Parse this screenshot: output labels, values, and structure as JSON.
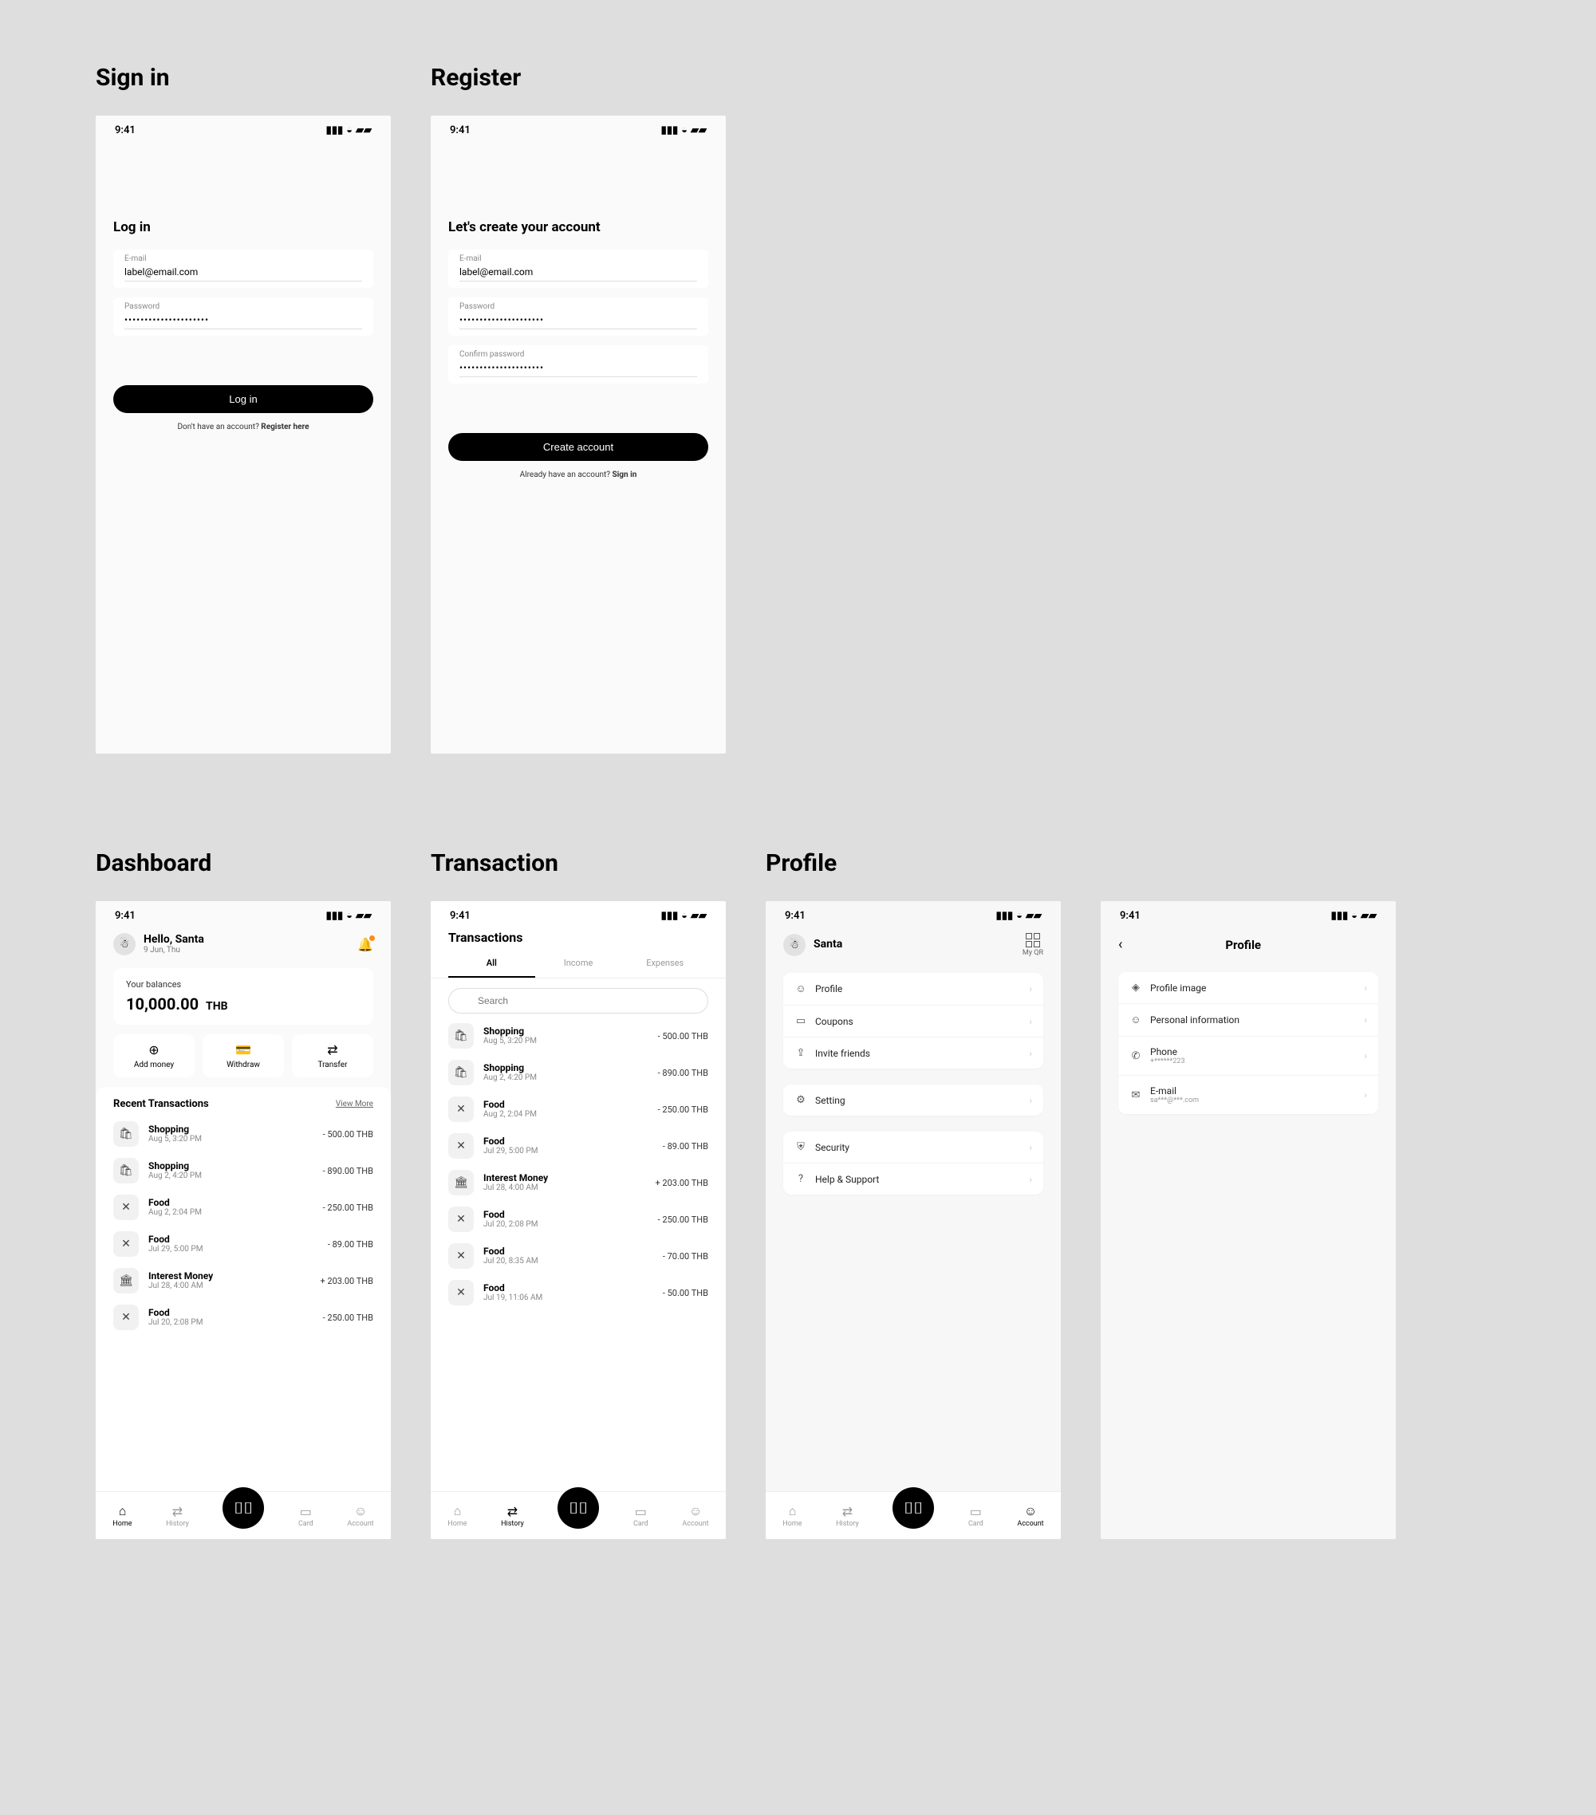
{
  "status": {
    "time": "9:41"
  },
  "signin": {
    "section": "Sign in",
    "heading": "Log in",
    "email_label": "E-mail",
    "email_value": "label@email.com",
    "password_label": "Password",
    "password_value": "•••••••••••••••••••••",
    "button": "Log in",
    "sub_pre": "Don't have an account? ",
    "sub_bold": "Register here"
  },
  "register": {
    "section": "Register",
    "heading": "Let's create your account",
    "email_label": "E-mail",
    "email_value": "label@email.com",
    "password_label": "Password",
    "password_value": "•••••••••••••••••••••",
    "confirm_label": "Confirm password",
    "confirm_value": "•••••••••••••••••••••",
    "button": "Create account",
    "sub_pre": "Already have an account? ",
    "sub_bold": "Sign in"
  },
  "dashboard": {
    "section": "Dashboard",
    "greeting": "Hello, Santa",
    "date": "9 Jun, Thu",
    "balance_label": "Your balances",
    "balance_amount": "10,000.00",
    "balance_currency": "THB",
    "actions": {
      "add": "Add money",
      "withdraw": "Withdraw",
      "transfer": "Transfer"
    },
    "recent_title": "Recent Transactions",
    "view_more": "View More",
    "tx": [
      {
        "icon": "bag",
        "title": "Shopping",
        "date": "Aug 5, 3:20 PM",
        "amount": "- 500.00  THB"
      },
      {
        "icon": "bag",
        "title": "Shopping",
        "date": "Aug 2, 4:20 PM",
        "amount": "- 890.00  THB"
      },
      {
        "icon": "food",
        "title": "Food",
        "date": "Aug 2, 2:04 PM",
        "amount": "- 250.00  THB"
      },
      {
        "icon": "food",
        "title": "Food",
        "date": "Jul 29, 5:00 PM",
        "amount": "- 89.00  THB"
      },
      {
        "icon": "bank",
        "title": "Interest Money",
        "date": "Jul 28, 4:00 AM",
        "amount": "+ 203.00  THB"
      },
      {
        "icon": "food",
        "title": "Food",
        "date": "Jul 20, 2:08 PM",
        "amount": "- 250.00  THB"
      }
    ],
    "nav": {
      "home": "Home",
      "history": "History",
      "card": "Card",
      "account": "Account"
    }
  },
  "transactions": {
    "section": "Transaction",
    "title": "Transactions",
    "tabs": {
      "all": "All",
      "income": "Income",
      "expenses": "Expenses"
    },
    "search_placeholder": "Search",
    "tx": [
      {
        "icon": "bag",
        "title": "Shopping",
        "date": "Aug 5, 3:20 PM",
        "amount": "- 500.00  THB"
      },
      {
        "icon": "bag",
        "title": "Shopping",
        "date": "Aug 2, 4:20 PM",
        "amount": "- 890.00  THB"
      },
      {
        "icon": "food",
        "title": "Food",
        "date": "Aug 2, 2:04 PM",
        "amount": "- 250.00  THB"
      },
      {
        "icon": "food",
        "title": "Food",
        "date": "Jul 29, 5:00 PM",
        "amount": "- 89.00  THB"
      },
      {
        "icon": "bank",
        "title": "Interest Money",
        "date": "Jul 28, 4:00 AM",
        "amount": "+ 203.00  THB"
      },
      {
        "icon": "food",
        "title": "Food",
        "date": "Jul 20, 2:08 PM",
        "amount": "- 250.00  THB"
      },
      {
        "icon": "food",
        "title": "Food",
        "date": "Jul 20, 8:35 AM",
        "amount": "- 70.00  THB"
      },
      {
        "icon": "food",
        "title": "Food",
        "date": "Jul 19, 11:06 AM",
        "amount": "- 50.00  THB"
      }
    ]
  },
  "profile": {
    "section": "Profile",
    "name": "Santa",
    "myqr": "My QR",
    "group1": [
      {
        "icon": "user",
        "label": "Profile"
      },
      {
        "icon": "coupon",
        "label": "Coupons"
      },
      {
        "icon": "invite",
        "label": "Invite friends"
      }
    ],
    "group2": [
      {
        "icon": "gear",
        "label": "Setting"
      }
    ],
    "group3": [
      {
        "icon": "shield",
        "label": "Security"
      },
      {
        "icon": "help",
        "label": "Help & Support"
      }
    ]
  },
  "profile_detail": {
    "title": "Profile",
    "items": [
      {
        "icon": "image",
        "label": "Profile image",
        "sub": ""
      },
      {
        "icon": "user",
        "label": "Personal information",
        "sub": ""
      },
      {
        "icon": "phone",
        "label": "Phone",
        "sub": "+******223"
      },
      {
        "icon": "mail",
        "label": "E-mail",
        "sub": "sa***@***.com"
      }
    ]
  }
}
